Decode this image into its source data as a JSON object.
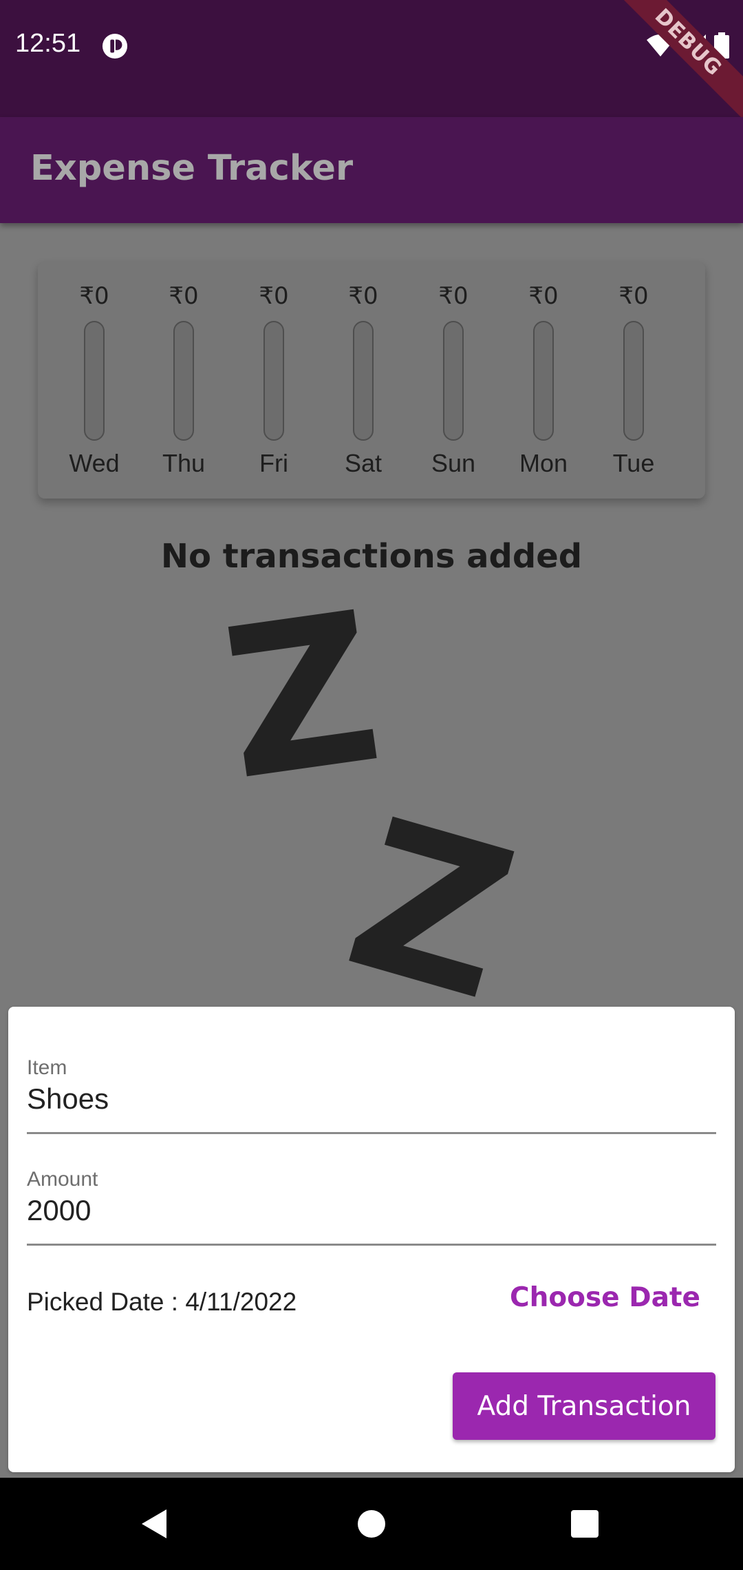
{
  "status": {
    "time": "12:51",
    "debug": "DEBUG"
  },
  "appbar": {
    "title": "Expense Tracker"
  },
  "chart_data": {
    "type": "bar",
    "categories": [
      "Wed",
      "Thu",
      "Fri",
      "Sat",
      "Sun",
      "Mon",
      "Tue"
    ],
    "values": [
      0,
      0,
      0,
      0,
      0,
      0,
      0
    ],
    "amount_labels": [
      "₹0",
      "₹0",
      "₹0",
      "₹0",
      "₹0",
      "₹0",
      "₹0"
    ],
    "fill_fractions": [
      0,
      0,
      0,
      0,
      0,
      0,
      0
    ]
  },
  "empty": {
    "title": "No transactions added",
    "z1": "Z",
    "z2": "Z"
  },
  "form": {
    "item": {
      "label": "Item",
      "value": "Shoes"
    },
    "amount": {
      "label": "Amount",
      "value": "2000"
    },
    "picked_date": "Picked Date : 4/11/2022",
    "choose_date": "Choose Date",
    "submit": "Add Transaction"
  },
  "colors": {
    "primary": "#9b27af",
    "appbar": "#4a1551",
    "statusbar": "#3c103f"
  },
  "icons": {
    "status_left": "app-notification-icon",
    "status_right": [
      "wifi-icon",
      "signal-icon",
      "battery-icon"
    ],
    "nav": [
      "back-icon",
      "home-icon",
      "recents-icon"
    ]
  }
}
